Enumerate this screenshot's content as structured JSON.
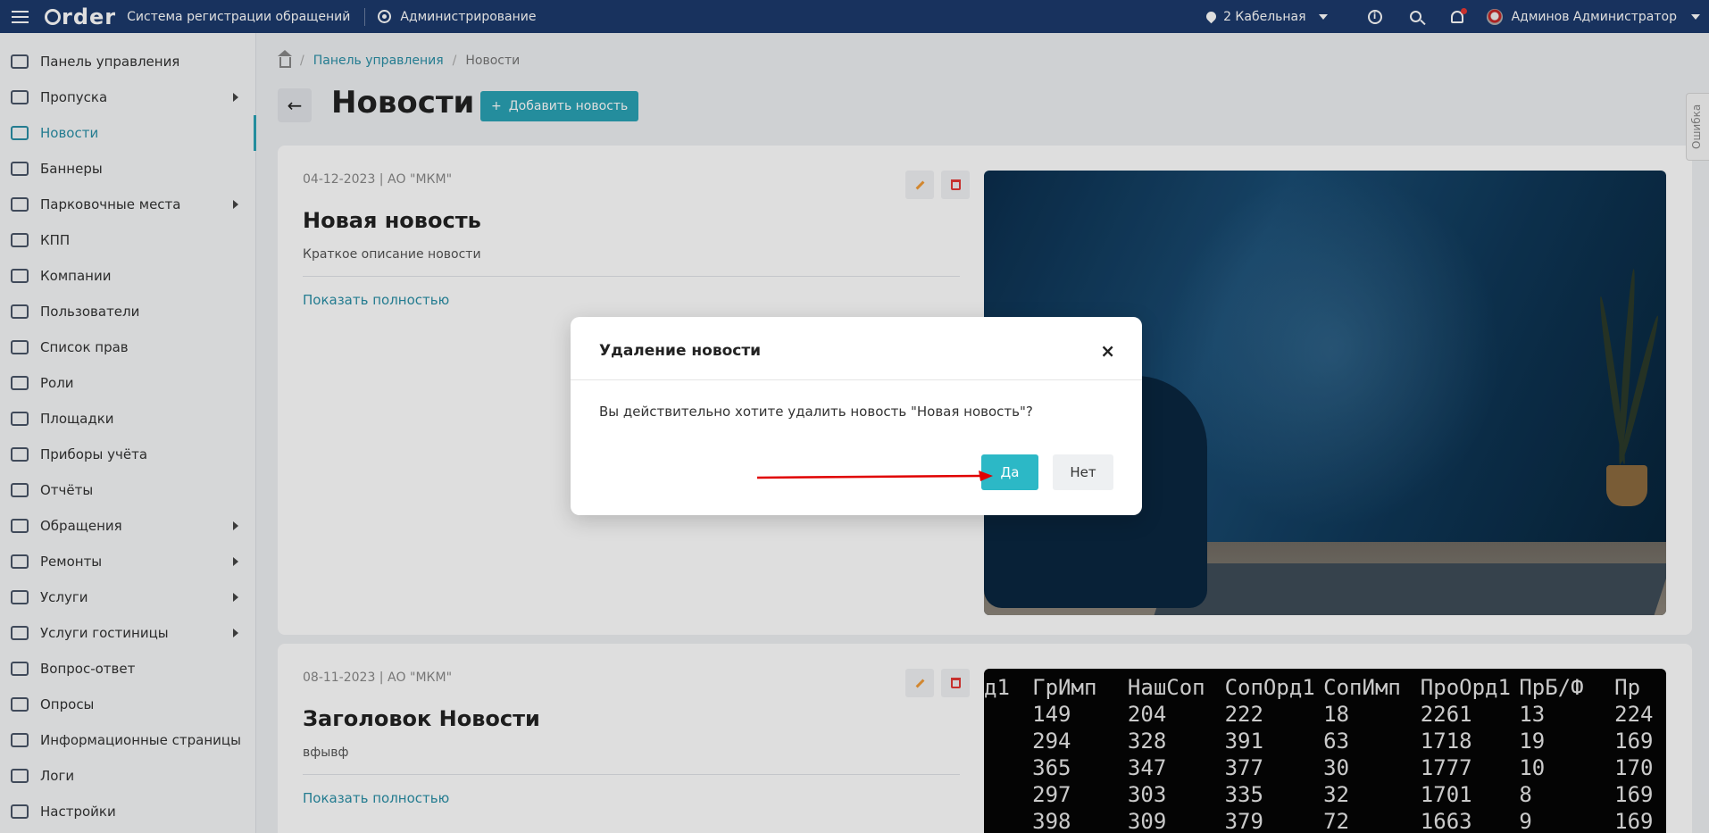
{
  "header": {
    "logo_text": "rder",
    "app_title": "Система регистрации обращений",
    "admin_label": "Администрирование",
    "location": "2 Кабельная",
    "info_glyph": "i",
    "user_name": "Админов Администратор"
  },
  "sidebar": {
    "items": [
      {
        "label": "Панель управления",
        "icon": "dashboard-icon"
      },
      {
        "label": "Пропуска",
        "icon": "pass-icon"
      },
      {
        "label": "Новости",
        "icon": "news-icon"
      },
      {
        "label": "Баннеры",
        "icon": "image-icon"
      },
      {
        "label": "Парковочные места",
        "icon": "car-icon"
      },
      {
        "label": "КПП",
        "icon": "checkpoint-icon"
      },
      {
        "label": "Компании",
        "icon": "building-icon"
      },
      {
        "label": "Пользователи",
        "icon": "users-icon"
      },
      {
        "label": "Список прав",
        "icon": "key-icon"
      },
      {
        "label": "Роли",
        "icon": "user-icon"
      },
      {
        "label": "Площадки",
        "icon": "location-icon"
      },
      {
        "label": "Приборы учёта",
        "icon": "meter-icon"
      },
      {
        "label": "Отчёты",
        "icon": "report-icon"
      },
      {
        "label": "Обращения",
        "icon": "book-icon"
      },
      {
        "label": "Ремонты",
        "icon": "wrench-icon"
      },
      {
        "label": "Услуги",
        "icon": "briefcase-icon"
      },
      {
        "label": "Услуги гостиницы",
        "icon": "hotel-icon"
      },
      {
        "label": "Вопрос-ответ",
        "icon": "faq-icon"
      },
      {
        "label": "Опросы",
        "icon": "poll-icon"
      },
      {
        "label": "Информационные страницы",
        "icon": "info-pages-icon"
      },
      {
        "label": "Логи",
        "icon": "log-icon"
      },
      {
        "label": "Настройки",
        "icon": "settings-icon"
      }
    ],
    "active_label": "Новости"
  },
  "breadcrumb": {
    "link": "Панель управления",
    "current": "Новости",
    "separator": "/"
  },
  "page": {
    "title": "Новости",
    "add_button": "Добавить новость",
    "back_glyph": "←",
    "plus_glyph": "+"
  },
  "news": [
    {
      "meta": "04-12-2023 | АО \"МКМ\"",
      "title": "Новая новость",
      "description": "Краткое описание новости",
      "more": "Показать полностью"
    },
    {
      "meta": "08-11-2023 | АО \"МКМ\"",
      "title": "Заголовок Новости",
      "description": "вфывф",
      "more": "Показать полностью"
    }
  ],
  "terminal": {
    "header": [
      "д1",
      "ГрИмп",
      "НашСоп",
      "СопОрд1",
      "СопИмп",
      "ПроОрд1",
      "ПрБ/Ф",
      "Пр"
    ],
    "rows": [
      [
        "",
        "149",
        "204",
        "222",
        "18",
        "2261",
        "13",
        "224"
      ],
      [
        "",
        "294",
        "328",
        "391",
        "63",
        "1718",
        "19",
        "169"
      ],
      [
        "",
        "365",
        "347",
        "377",
        "30",
        "1777",
        "10",
        "170"
      ],
      [
        "",
        "297",
        "303",
        "335",
        "32",
        "1701",
        "8",
        "169"
      ],
      [
        "",
        "398",
        "309",
        "379",
        "72",
        "1663",
        "9",
        "169"
      ]
    ]
  },
  "error_tab": "Ошибка",
  "modal": {
    "title": "Удаление новости",
    "close": "×",
    "message": "Вы действительно хотите удалить новость \"Новая новость\"?",
    "yes": "Да",
    "no": "Нет"
  },
  "colors": {
    "header_bg": "#1c3a6d",
    "accent": "#2aa3b5",
    "yes_button": "#2cb8c6",
    "arrow_annotation": "#e00000"
  }
}
